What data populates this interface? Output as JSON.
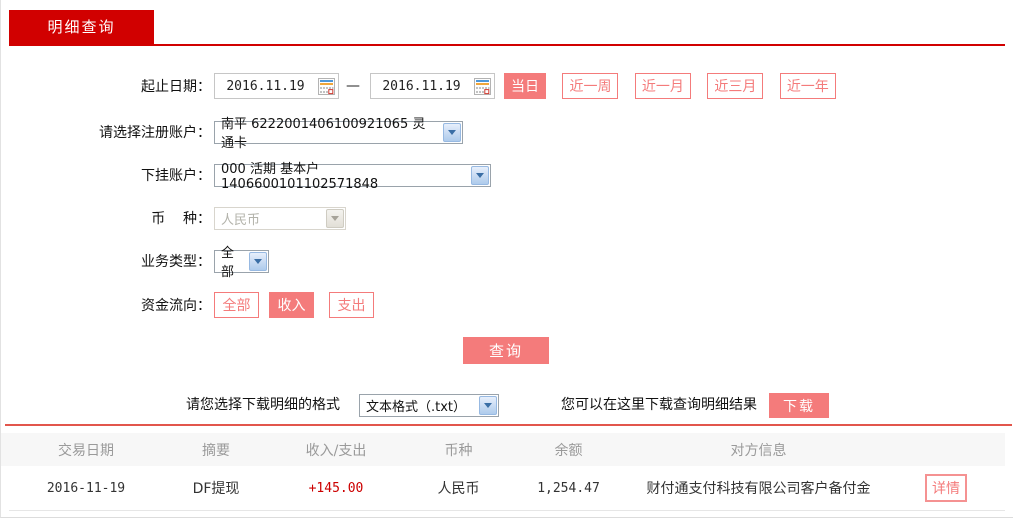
{
  "colors": {
    "tab_red": "#d10000",
    "salmon": "#f47b7b",
    "divider_red": "#e2564c",
    "income_red": "#cc0000"
  },
  "tab": {
    "label": "明细查询"
  },
  "form": {
    "date_range": {
      "label": "起止日期：",
      "start_value": "2016.11.19",
      "end_value": "2016.11.19",
      "separator": "—",
      "quick_buttons": [
        {
          "label": "当日",
          "active": true
        },
        {
          "label": "近一周",
          "active": false
        },
        {
          "label": "近一月",
          "active": false
        },
        {
          "label": "近三月",
          "active": false
        },
        {
          "label": "近一年",
          "active": false
        }
      ]
    },
    "register_account": {
      "label": "请选择注册账户：",
      "value": "南平 6222001406100921065 灵通卡"
    },
    "sub_account": {
      "label": "下挂账户：",
      "value": "000 活期 基本户 1406600101102571848"
    },
    "currency": {
      "label": "币    种：",
      "value": "人民币",
      "disabled": true
    },
    "business_type": {
      "label": "业务类型：",
      "value": "全部"
    },
    "fund_flow": {
      "label": "资金流向：",
      "buttons": [
        {
          "label": "全部",
          "active": false
        },
        {
          "label": "收入",
          "active": true
        },
        {
          "label": "支出",
          "active": false
        }
      ]
    },
    "query_button": "查询"
  },
  "download": {
    "format_label": "请您选择下载明细的格式",
    "format_value": "文本格式（.txt）",
    "hint": "您可以在这里下载查询明细结果",
    "button": "下载"
  },
  "table": {
    "headers": [
      "交易日期",
      "摘要",
      "收入/支出",
      "币种",
      "余额",
      "对方信息"
    ],
    "rows": [
      {
        "date": "2016-11-19",
        "summary": "DF提现",
        "amount": "+145.00",
        "currency": "人民币",
        "balance": "1,254.47",
        "counterparty": "财付通支付科技有限公司客户备付金",
        "detail_button": "详情"
      }
    ]
  }
}
